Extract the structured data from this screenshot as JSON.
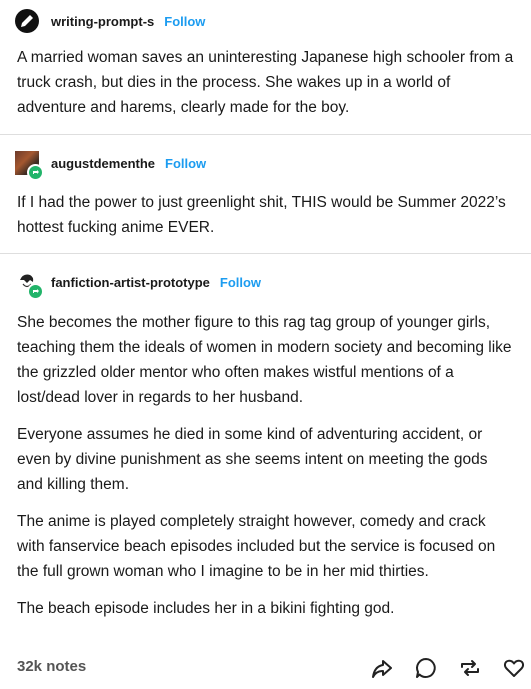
{
  "posts": [
    {
      "username": "writing-prompt-s",
      "follow_label": "Follow",
      "avatar_icon": "pen-nib-icon",
      "paragraphs": [
        "A married woman saves an uninteresting Japanese high schooler from a truck crash, but dies in the process. She wakes up in a world of adventure and harems, clearly made for the boy."
      ]
    },
    {
      "username": "augustdementhe",
      "follow_label": "Follow",
      "avatar_icon": "user-avatar-icon",
      "paragraphs": [
        "If I had the power to just greenlight shit, THIS would be Summer 2022’s hottest fucking anime EVER."
      ]
    },
    {
      "username": "fanfiction-artist-prototype",
      "follow_label": "Follow",
      "avatar_icon": "user-avatar-icon",
      "paragraphs": [
        "She becomes the mother figure to this rag tag group of younger girls, teaching them the ideals of women in modern society and becoming like the grizzled older mentor who often makes wistful mentions of a lost/dead lover in regards to her husband.",
        "Everyone assumes he died in some kind of adventuring accident, or even by divine punishment as she seems intent on meeting the gods and killing them.",
        "The anime is played completely straight however, comedy and crack with fanservice beach episodes included but the service is focused on the full grown woman who I imagine to be in her mid thirties.",
        "The beach episode includes her in a bikini fighting god."
      ]
    }
  ],
  "footer": {
    "notes": "32k notes",
    "actions": [
      "share-icon",
      "reply-icon",
      "reblog-icon",
      "like-icon"
    ]
  },
  "colors": {
    "follow": "#1c9cf0",
    "badge": "#22b46a",
    "divider": "#dedede"
  }
}
